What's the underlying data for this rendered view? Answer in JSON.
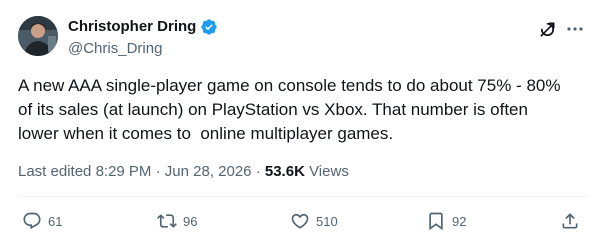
{
  "author": {
    "name": "Christopher Dring",
    "handle": "@Chris_Dring",
    "verified": true
  },
  "tweet": {
    "text": "A new AAA single-player game on console tends to do about 75% - 80%\nof its sales (at launch) on PlayStation vs Xbox. That number is often\nlower when it comes to  online multiplayer games.",
    "edited_label": "Last edited",
    "time": "8:29 PM",
    "separator": "·",
    "date": "Jun 28, 2026",
    "views_count": "53.6K",
    "views_label": "Views"
  },
  "actions": {
    "replies": "61",
    "retweets": "96",
    "likes": "510",
    "bookmarks": "92"
  },
  "colors": {
    "verified": "#1d9bf0",
    "secondary_text": "#536471",
    "primary_text": "#0f1419"
  },
  "icons": [
    "grok-icon",
    "more-icon",
    "reply-icon",
    "retweet-icon",
    "like-icon",
    "bookmark-icon",
    "share-icon"
  ]
}
